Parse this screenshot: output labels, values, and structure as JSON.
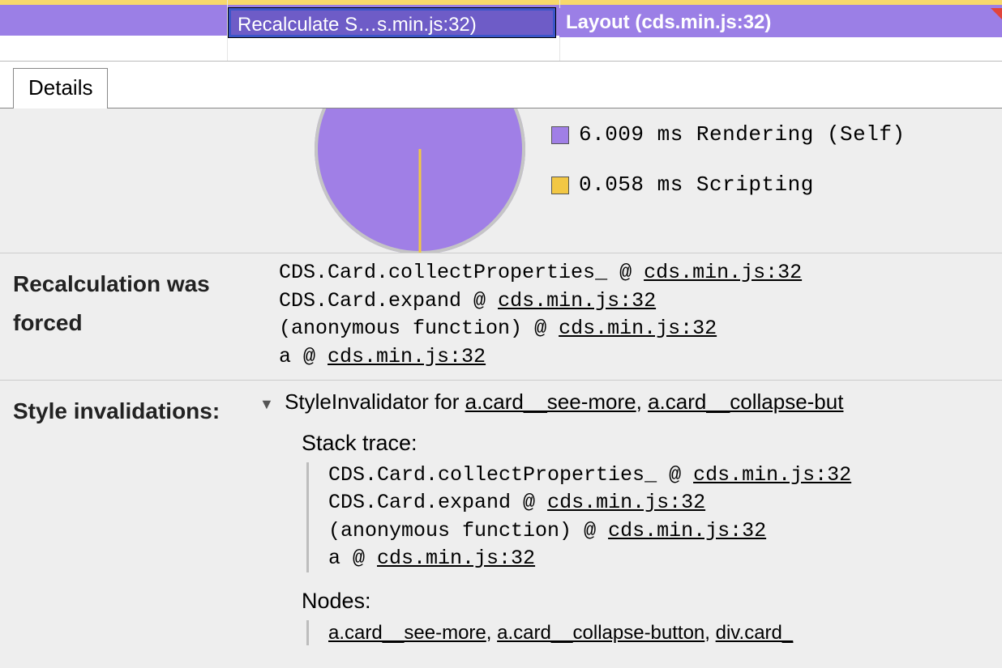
{
  "flamechart": {
    "recalc_label": "Recalculate S…s.min.js:32)",
    "layout_label": "Layout (cds.min.js:32)"
  },
  "tab": {
    "details": "Details"
  },
  "chart_data": {
    "type": "pie",
    "title": "",
    "series": [
      {
        "name": "Rendering (Self)",
        "value": 6.009,
        "unit": "ms",
        "color": "#a07fe6"
      },
      {
        "name": "Scripting",
        "value": 0.058,
        "unit": "ms",
        "color": "#f2c744"
      }
    ]
  },
  "legend": {
    "rendering": "6.009 ms Rendering (Self)",
    "scripting": "0.058 ms Scripting"
  },
  "sections": {
    "recalc_label": "Recalculation was forced",
    "style_inval_label": "Style invalidations:"
  },
  "frames": {
    "f1_fn": "CDS.Card.collectProperties_",
    "f2_fn": "CDS.Card.expand",
    "f3_fn": "(anonymous function)",
    "f4_fn": "a",
    "at": " @ ",
    "loc": "cds.min.js:32"
  },
  "invalidator": {
    "prefix": "StyleInvalidator for ",
    "sel1": "a.card__see-more",
    "sel2": "a.card__collapse-but",
    "comma": ", ",
    "stack_trace": "Stack trace:",
    "nodes": "Nodes:",
    "node1": "a.card__see-more",
    "node2": "a.card__collapse-button",
    "node3": "div.card_"
  }
}
